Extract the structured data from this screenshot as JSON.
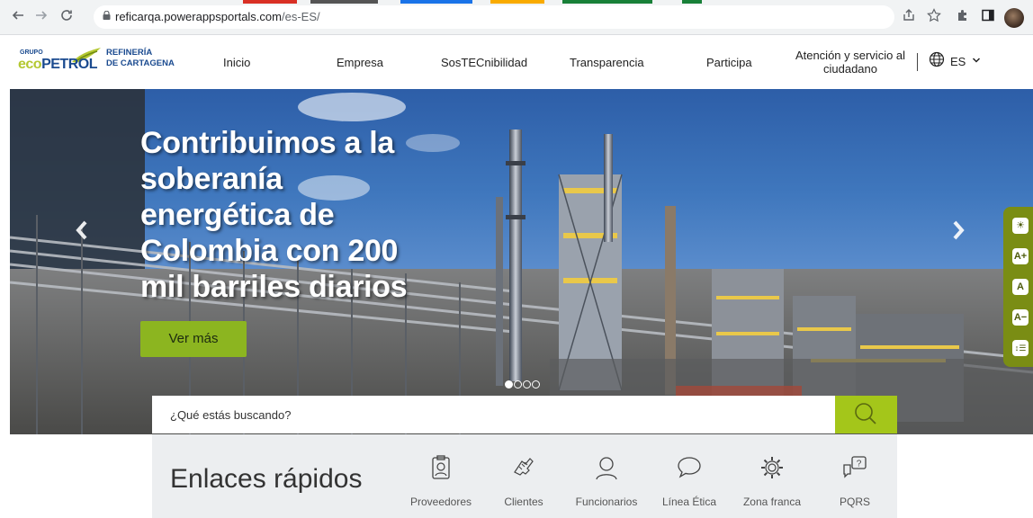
{
  "browser": {
    "url_host": "reficarqa.powerappsportals.com",
    "url_path": "/es-ES/",
    "back_icon": "arrow-left-icon",
    "forward_icon": "arrow-right-icon",
    "reload_icon": "reload-icon"
  },
  "header": {
    "logo": {
      "grupo": "GRUPO",
      "eco_prefix": "eco",
      "eco_suffix": "PETROL",
      "ref_line1": "REFINERÍA",
      "ref_line2": "DE CARTAGENA"
    },
    "nav": [
      "Inicio",
      "Empresa",
      "SosTECnibilidad",
      "Transparencia",
      "Participa"
    ],
    "atencion_line1": "Atención y servicio al",
    "atencion_line2": "ciudadano",
    "language": "ES"
  },
  "hero": {
    "headline_lines": [
      "Contribuimos a la",
      "soberanía",
      "energética de",
      "Colombia con 200",
      "mil barriles diarios"
    ],
    "cta": "Ver más",
    "slide_count": 4,
    "active_slide": 1
  },
  "accessibility": {
    "buttons": [
      "☀",
      "A+",
      "A",
      "A−",
      "↕☰"
    ]
  },
  "search": {
    "placeholder": "¿Qué estás buscando?"
  },
  "quick_links": {
    "title": "Enlaces rápidos",
    "items": [
      {
        "label": "Proveedores",
        "icon": "clipboard-user-icon"
      },
      {
        "label": "Clientes",
        "icon": "handshake-icon"
      },
      {
        "label": "Funcionarios",
        "icon": "person-icon"
      },
      {
        "label": "Línea Ética",
        "icon": "speech-bubble-icon"
      },
      {
        "label": "Zona franca",
        "icon": "gear-icon"
      },
      {
        "label": "PQRS",
        "icon": "question-chat-icon"
      }
    ]
  },
  "colors": {
    "accent_green": "#a4c61a",
    "button_green": "#8cb520",
    "a11y_bar": "#7a8d14",
    "brand_blue": "#1a4a8f"
  }
}
